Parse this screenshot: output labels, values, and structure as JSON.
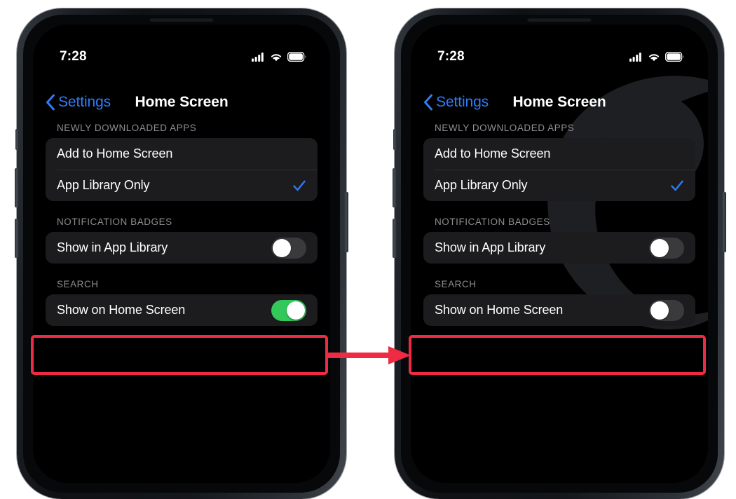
{
  "page": {
    "title": "iPhone Settings — Home Screen — Show on Home Screen toggle",
    "background_color": "#ffffff",
    "accent_blue": "#2f7cf6",
    "toggle_on_color": "#32c85a",
    "toggle_off_color": "#3a3a3c",
    "annotation_color": "#ee2b42"
  },
  "phones": [
    {
      "id": "before",
      "status_bar": {
        "time": "7:28",
        "cellular_icon": "cellular-signal-icon",
        "wifi_icon": "wifi-icon",
        "battery_icon": "battery-icon"
      },
      "nav": {
        "back_icon": "chevron-left-icon",
        "back_label": "Settings",
        "title": "Home Screen"
      },
      "sections": [
        {
          "header": "NEWLY DOWNLOADED APPS",
          "rows": [
            {
              "label": "Add to Home Screen",
              "control": "none",
              "checked": false
            },
            {
              "label": "App Library Only",
              "control": "checkmark",
              "checked": true
            }
          ]
        },
        {
          "header": "NOTIFICATION BADGES",
          "rows": [
            {
              "label": "Show in App Library",
              "control": "switch",
              "switch_on": false
            }
          ]
        },
        {
          "header": "SEARCH",
          "rows": [
            {
              "label": "Show on Home Screen",
              "control": "switch",
              "switch_on": true
            }
          ]
        }
      ]
    },
    {
      "id": "after",
      "status_bar": {
        "time": "7:28",
        "cellular_icon": "cellular-signal-icon",
        "wifi_icon": "wifi-icon",
        "battery_icon": "battery-icon"
      },
      "nav": {
        "back_icon": "chevron-left-icon",
        "back_label": "Settings",
        "title": "Home Screen"
      },
      "sections": [
        {
          "header": "NEWLY DOWNLOADED APPS",
          "rows": [
            {
              "label": "Add to Home Screen",
              "control": "none",
              "checked": false
            },
            {
              "label": "App Library Only",
              "control": "checkmark",
              "checked": true
            }
          ]
        },
        {
          "header": "NOTIFICATION BADGES",
          "rows": [
            {
              "label": "Show in App Library",
              "control": "switch",
              "switch_on": false
            }
          ]
        },
        {
          "header": "SEARCH",
          "rows": [
            {
              "label": "Show on Home Screen",
              "control": "switch",
              "switch_on": false
            }
          ]
        }
      ]
    }
  ],
  "annotations": {
    "highlight_left": "red-highlight-box",
    "highlight_right": "red-highlight-box",
    "arrow": "red-right-arrow"
  }
}
